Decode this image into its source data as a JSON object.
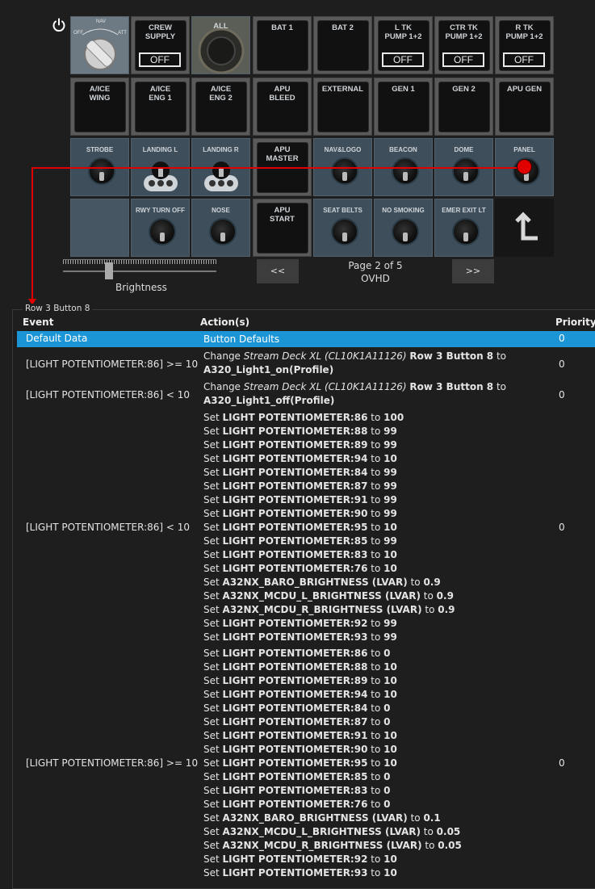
{
  "deck": {
    "keys": [
      {
        "id": "nav",
        "type": "selector",
        "labels": [
          "OFF",
          "NAV",
          "ATT"
        ]
      },
      {
        "id": "crew",
        "label": "CREW\nSUPPLY",
        "off": "OFF"
      },
      {
        "id": "all",
        "label": "ALL"
      },
      {
        "id": "bat1",
        "label": "BAT 1"
      },
      {
        "id": "bat2",
        "label": "BAT 2"
      },
      {
        "id": "ltk",
        "label": "L TK\nPUMP 1+2",
        "off": "OFF"
      },
      {
        "id": "ctrtk",
        "label": "CTR TK\nPUMP 1+2",
        "off": "OFF"
      },
      {
        "id": "rtk",
        "label": "R TK\nPUMP 1+2",
        "off": "OFF"
      },
      {
        "id": "aicewing",
        "label": "A/ICE\nWING"
      },
      {
        "id": "aiceeng1",
        "label": "A/ICE\nENG 1"
      },
      {
        "id": "aiceeng2",
        "label": "A/ICE\nENG 2"
      },
      {
        "id": "apubleed",
        "label": "APU\nBLEED"
      },
      {
        "id": "external",
        "label": "EXTERNAL"
      },
      {
        "id": "gen1",
        "label": "GEN 1"
      },
      {
        "id": "gen2",
        "label": "GEN 2"
      },
      {
        "id": "apugen",
        "label": "APU GEN"
      },
      {
        "id": "strobe",
        "label": "STROBE"
      },
      {
        "id": "landingl",
        "label": "LANDING L"
      },
      {
        "id": "landingr",
        "label": "LANDING R"
      },
      {
        "id": "apumaster",
        "label": "APU\nMASTER"
      },
      {
        "id": "navlogo",
        "label": "NAV&LOGO"
      },
      {
        "id": "beacon",
        "label": "BEACON"
      },
      {
        "id": "dome",
        "label": "DOME"
      },
      {
        "id": "panel",
        "label": "PANEL"
      },
      {
        "id": "empty",
        "label": ""
      },
      {
        "id": "rwyturnoff",
        "label": "RWY TURN OFF"
      },
      {
        "id": "nose",
        "label": "NOSE"
      },
      {
        "id": "apustart",
        "label": "APU\nSTART"
      },
      {
        "id": "seatbelts",
        "label": "SEAT BELTS"
      },
      {
        "id": "nosmoking",
        "label": "NO SMOKING"
      },
      {
        "id": "emerexit",
        "label": "EMER EXIT LT"
      },
      {
        "id": "back",
        "label": ""
      }
    ]
  },
  "controls": {
    "prev": "<<",
    "next": ">>",
    "page": "Page 2 of 5",
    "profile": "OVHD",
    "brightness_label": "Brightness"
  },
  "group_title": "Row 3 Button 8",
  "headers": {
    "event": "Event",
    "actions": "Action(s)",
    "priority": "Priority"
  },
  "rows": [
    {
      "event": "Default Data",
      "priority": "0",
      "selected": true,
      "actions": [
        [
          "Button Defaults"
        ]
      ]
    },
    {
      "event": "[LIGHT POTENTIOMETER:86] >= 10",
      "priority": "0",
      "actions": [
        [
          "Change ",
          {
            "i": "Stream Deck XL (CL10K1A11126)"
          },
          " ",
          {
            "b": "Row 3 Button 8"
          },
          " to"
        ],
        [
          {
            "b": "A320_Light1_on(Profile)"
          }
        ]
      ]
    },
    {
      "event": "[LIGHT POTENTIOMETER:86] < 10",
      "priority": "0",
      "actions": [
        [
          "Change ",
          {
            "i": "Stream Deck XL (CL10K1A11126)"
          },
          " ",
          {
            "b": "Row 3 Button 8"
          },
          " to"
        ],
        [
          {
            "b": "A320_Light1_off(Profile)"
          }
        ]
      ]
    },
    {
      "event": "[LIGHT POTENTIOMETER:86] < 10",
      "priority": "0",
      "actions": [
        [
          "Set ",
          {
            "b": "LIGHT POTENTIOMETER:86"
          },
          " to ",
          {
            "b": "100"
          }
        ],
        [
          "Set ",
          {
            "b": "LIGHT POTENTIOMETER:88"
          },
          " to ",
          {
            "b": "99"
          }
        ],
        [
          "Set ",
          {
            "b": "LIGHT POTENTIOMETER:89"
          },
          " to ",
          {
            "b": "99"
          }
        ],
        [
          "Set ",
          {
            "b": "LIGHT POTENTIOMETER:94"
          },
          " to ",
          {
            "b": "10"
          }
        ],
        [
          "Set ",
          {
            "b": "LIGHT POTENTIOMETER:84"
          },
          " to ",
          {
            "b": "99"
          }
        ],
        [
          "Set ",
          {
            "b": "LIGHT POTENTIOMETER:87"
          },
          " to ",
          {
            "b": "99"
          }
        ],
        [
          "Set ",
          {
            "b": "LIGHT POTENTIOMETER:91"
          },
          " to ",
          {
            "b": "99"
          }
        ],
        [
          "Set ",
          {
            "b": "LIGHT POTENTIOMETER:90"
          },
          " to ",
          {
            "b": "99"
          }
        ],
        [
          "Set ",
          {
            "b": "LIGHT POTENTIOMETER:95"
          },
          " to ",
          {
            "b": "10"
          }
        ],
        [
          "Set ",
          {
            "b": "LIGHT POTENTIOMETER:85"
          },
          " to ",
          {
            "b": "99"
          }
        ],
        [
          "Set ",
          {
            "b": "LIGHT POTENTIOMETER:83"
          },
          " to ",
          {
            "b": "10"
          }
        ],
        [
          "Set ",
          {
            "b": "LIGHT POTENTIOMETER:76"
          },
          " to ",
          {
            "b": "10"
          }
        ],
        [
          "Set ",
          {
            "b": "A32NX_BARO_BRIGHTNESS (LVAR)"
          },
          " to ",
          {
            "b": "0.9"
          }
        ],
        [
          "Set ",
          {
            "b": "A32NX_MCDU_L_BRIGHTNESS (LVAR)"
          },
          " to ",
          {
            "b": "0.9"
          }
        ],
        [
          "Set ",
          {
            "b": "A32NX_MCDU_R_BRIGHTNESS (LVAR)"
          },
          " to ",
          {
            "b": "0.9"
          }
        ],
        [
          "Set ",
          {
            "b": "LIGHT POTENTIOMETER:92"
          },
          " to ",
          {
            "b": "99"
          }
        ],
        [
          "Set ",
          {
            "b": "LIGHT POTENTIOMETER:93"
          },
          " to ",
          {
            "b": "99"
          }
        ]
      ]
    },
    {
      "event": "[LIGHT POTENTIOMETER:86] >= 10",
      "priority": "0",
      "actions": [
        [
          "Set ",
          {
            "b": "LIGHT POTENTIOMETER:86"
          },
          " to ",
          {
            "b": "0"
          }
        ],
        [
          "Set ",
          {
            "b": "LIGHT POTENTIOMETER:88"
          },
          " to ",
          {
            "b": "10"
          }
        ],
        [
          "Set ",
          {
            "b": "LIGHT POTENTIOMETER:89"
          },
          " to ",
          {
            "b": "10"
          }
        ],
        [
          "Set ",
          {
            "b": "LIGHT POTENTIOMETER:94"
          },
          " to ",
          {
            "b": "10"
          }
        ],
        [
          "Set ",
          {
            "b": "LIGHT POTENTIOMETER:84"
          },
          " to ",
          {
            "b": "0"
          }
        ],
        [
          "Set ",
          {
            "b": "LIGHT POTENTIOMETER:87"
          },
          " to ",
          {
            "b": "0"
          }
        ],
        [
          "Set ",
          {
            "b": "LIGHT POTENTIOMETER:91"
          },
          " to ",
          {
            "b": "10"
          }
        ],
        [
          "Set ",
          {
            "b": "LIGHT POTENTIOMETER:90"
          },
          " to ",
          {
            "b": "10"
          }
        ],
        [
          "Set ",
          {
            "b": "LIGHT POTENTIOMETER:95"
          },
          " to ",
          {
            "b": "10"
          }
        ],
        [
          "Set ",
          {
            "b": "LIGHT POTENTIOMETER:85"
          },
          " to ",
          {
            "b": "0"
          }
        ],
        [
          "Set ",
          {
            "b": "LIGHT POTENTIOMETER:83"
          },
          " to ",
          {
            "b": "0"
          }
        ],
        [
          "Set ",
          {
            "b": "LIGHT POTENTIOMETER:76"
          },
          " to ",
          {
            "b": "0"
          }
        ],
        [
          "Set ",
          {
            "b": "A32NX_BARO_BRIGHTNESS (LVAR)"
          },
          " to ",
          {
            "b": "0.1"
          }
        ],
        [
          "Set ",
          {
            "b": "A32NX_MCDU_L_BRIGHTNESS (LVAR)"
          },
          " to ",
          {
            "b": "0.05"
          }
        ],
        [
          "Set ",
          {
            "b": "A32NX_MCDU_R_BRIGHTNESS (LVAR)"
          },
          " to ",
          {
            "b": "0.05"
          }
        ],
        [
          "Set ",
          {
            "b": "LIGHT POTENTIOMETER:92"
          },
          " to ",
          {
            "b": "10"
          }
        ],
        [
          "Set ",
          {
            "b": "LIGHT POTENTIOMETER:93"
          },
          " to ",
          {
            "b": "10"
          }
        ]
      ]
    }
  ]
}
